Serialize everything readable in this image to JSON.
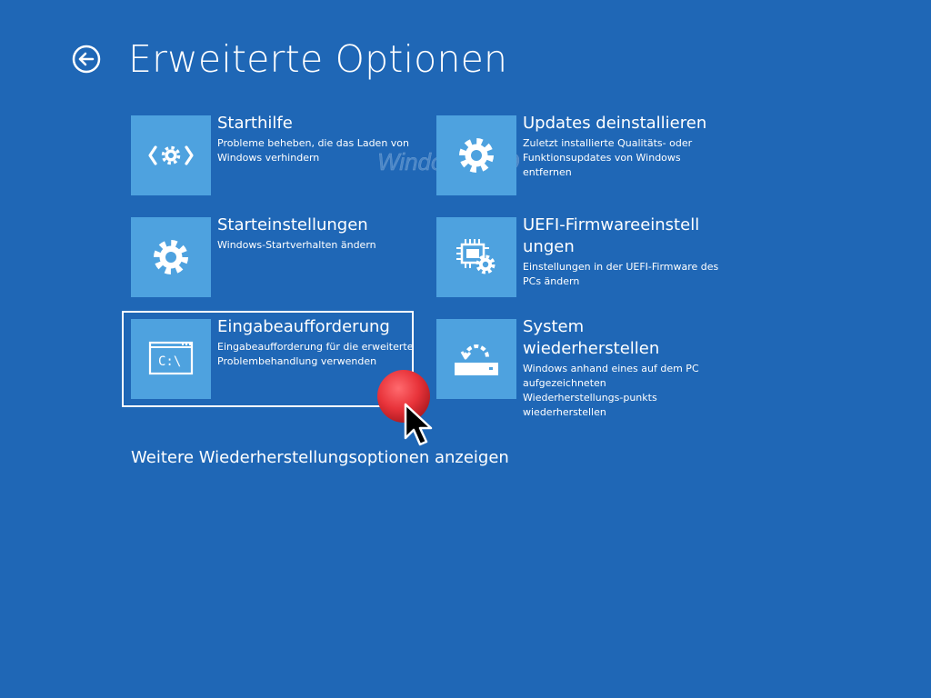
{
  "page": {
    "title": "Erweiterte Optionen",
    "back_icon": "back-arrow-circle-icon",
    "more_link": "Weitere Wiederherstellungsoptionen anzeigen"
  },
  "options": [
    {
      "name": "Starthilfe",
      "description": "Probleme beheben, die das Laden von Windows verhindern",
      "icon": "startup-repair-icon"
    },
    {
      "name": "Updates deinstallieren",
      "description": "Zuletzt installierte Qualitäts- oder Funktionsupdates von Windows entfernen",
      "icon": "gear-icon"
    },
    {
      "name": "Starteinstellungen",
      "description": "Windows-Startverhalten ändern",
      "icon": "gear-icon"
    },
    {
      "name": "UEFI-Firmwareeinstellungen",
      "description": "Einstellungen in der UEFI-Firmware des PCs ändern",
      "icon": "chip-gear-icon"
    },
    {
      "name": "Eingabeaufforderung",
      "description": "Eingabeaufforderung für die erweiterte Problembehandlung verwenden",
      "icon": "command-prompt-icon",
      "selected": true
    },
    {
      "name": "System wiederherstellen",
      "description": "Windows anhand eines auf dem PC aufgezeichneten Wiederherstellungs-punkts wiederherstellen",
      "icon": "system-restore-icon"
    }
  ],
  "watermark": "WindowsFAQ",
  "colors": {
    "background": "#1f67b6",
    "tile": "#4ea2df",
    "text": "#ffffff",
    "click_marker": "#e8333a"
  }
}
